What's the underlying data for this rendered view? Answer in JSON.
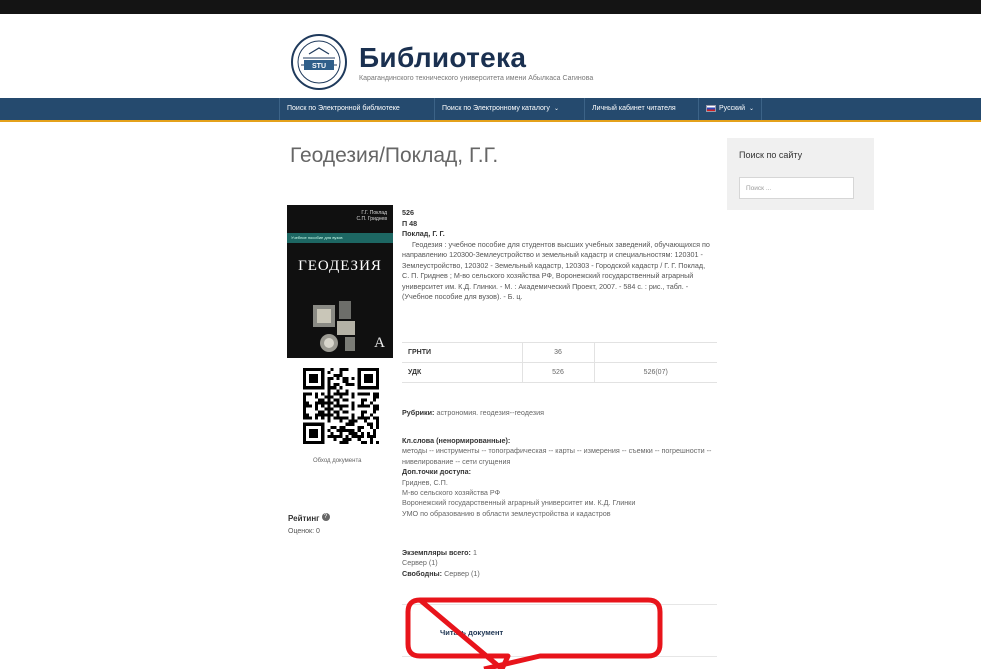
{
  "header": {
    "title": "Библиотека",
    "subtitle": "Карагандинского технического университета имени Абылкаса Сагинова",
    "logo_text": "STU"
  },
  "nav": {
    "items": [
      {
        "label": "Поиск по Электронной библиотеке"
      },
      {
        "label": "Поиск по Электронному каталогу",
        "caret": "⌄"
      },
      {
        "label": "Личный кабинет читателя"
      },
      {
        "label": "Русский",
        "caret": "⌄"
      }
    ]
  },
  "page": {
    "title": "Геодезия/Поклад, Г.Г."
  },
  "cover": {
    "authors": [
      "Г.Г. Поклад",
      "С.П. Гриднев"
    ],
    "series": "Учебное пособие для вузов",
    "title": "ГЕОДЕЗИЯ",
    "publisher_mark": "A"
  },
  "qr": {
    "caption": "Обход документа"
  },
  "rating": {
    "label": "Рейтинг",
    "icon": "?",
    "votes": "Оценок: 0"
  },
  "record": {
    "code1": "526",
    "code2": "П 48",
    "author": "Поклад, Г. Г.",
    "description": "Геодезия : учебное пособие для студентов высших учебных заведений, обучающихся по направлению 120300-Землеустройство и земельный кадастр и специальностям: 120301 - Землеустройство, 120302 - Земельный кадастр, 120303 - Городской кадастр / Г. Г. Поклад, С. П. Гриднев ; М-во сельского хозяйства РФ, Воронежский государственный аграрный университет им. К.Д. Глинки. - М. : Академический Проект, 2007. - 584 с. : рис., табл. - (Учебное пособие для вузов). - Б. ц."
  },
  "classification": {
    "rows": [
      {
        "key": "ГРНТИ",
        "v1": "36",
        "v2": ""
      },
      {
        "key": "УДК",
        "v1": "526",
        "v2": "526(07)"
      }
    ]
  },
  "rubrics": {
    "label": "Рубрики:",
    "value": "астрономия. геодезия--геодезия"
  },
  "keywords": {
    "label": "Кл.слова (ненормированные):",
    "value": "методы -- инструменты -- топографическая -- карты -- измерения -- съемки -- погрешности -- нивелирование -- сети сгущения"
  },
  "access_points": {
    "label": "Доп.точки доступа:",
    "items": [
      "Гриднев, С.П.",
      "М-во сельского хозяйства РФ",
      "Воронежский государственный аграрный университет им. К.Д. Глинки",
      "УМО по образованию в области землеустройства и кадастров"
    ]
  },
  "copies": {
    "total_label": "Экземпляры всего:",
    "total_value": "1",
    "server": "Сервер (1)",
    "free_label": "Свободны:",
    "free_value": "Сервер (1)"
  },
  "read": {
    "label": "Читать документ"
  },
  "sidebar": {
    "title": "Поиск по сайту",
    "search_placeholder": "Поиск ..."
  },
  "colors": {
    "navbar": "#254a6e",
    "navbar_border": "#e4a11b",
    "title": "#1a3050",
    "callout": "#e8141b"
  }
}
